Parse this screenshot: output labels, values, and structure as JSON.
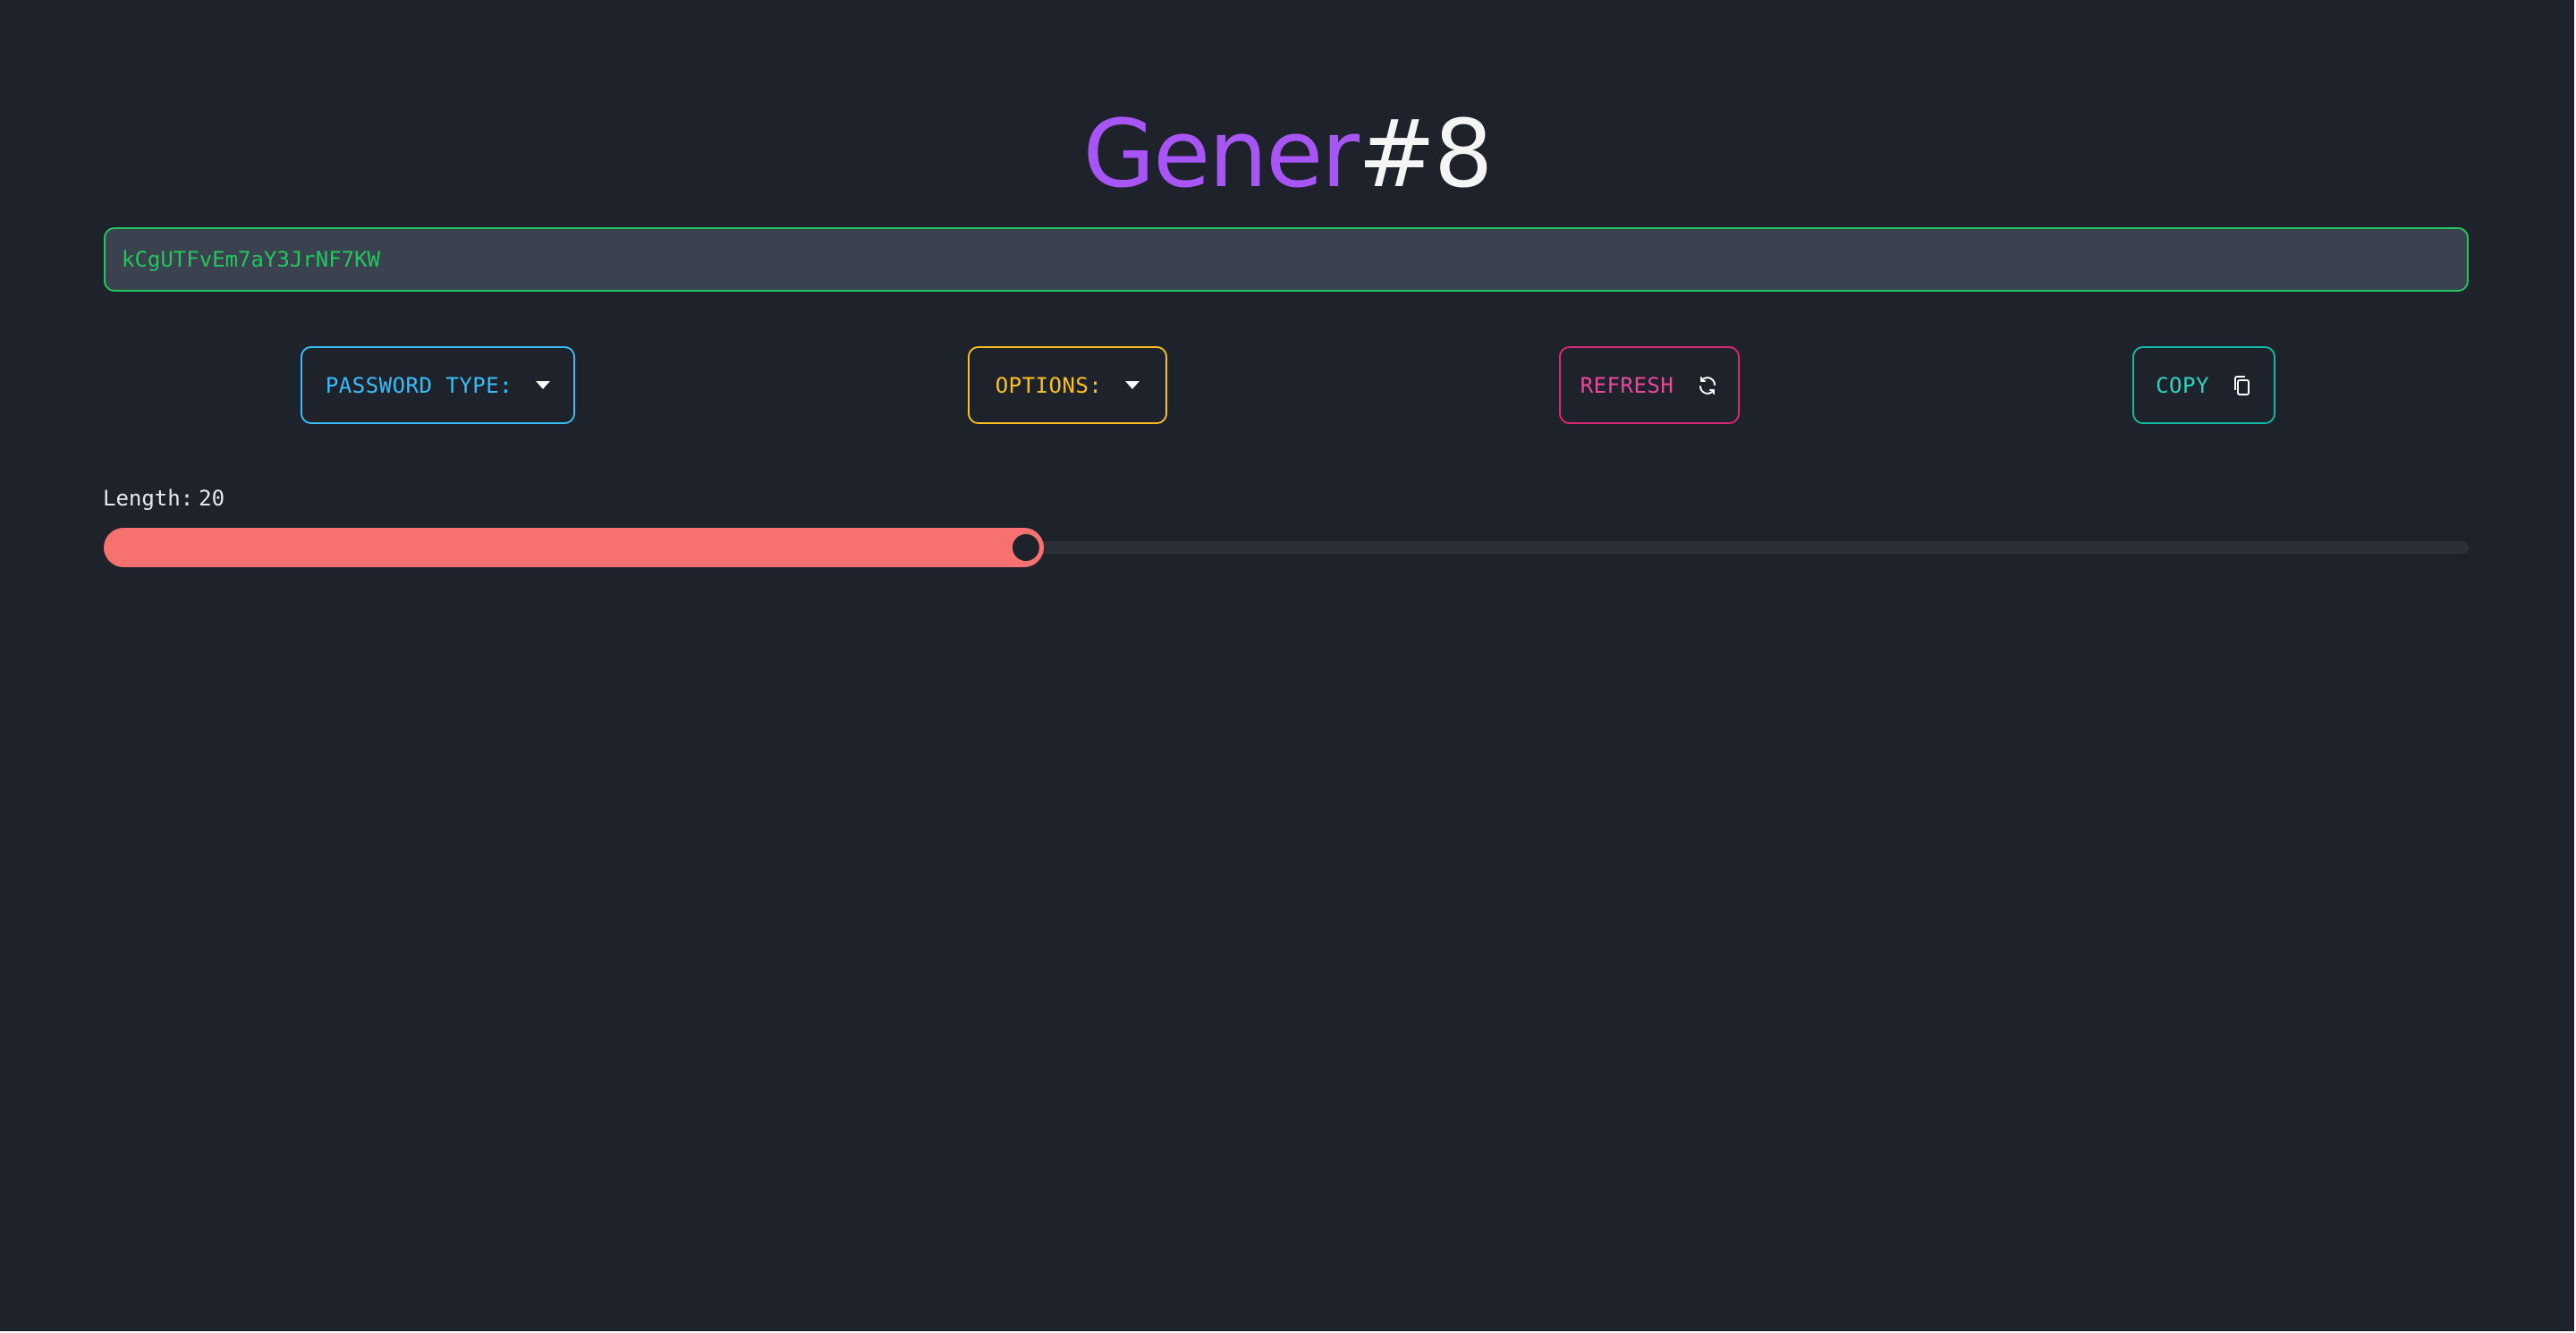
{
  "app": {
    "title_part1": "Gener",
    "title_part2": "#8"
  },
  "output": {
    "password": "kCgUTFvEm7aY3JrNF7KW"
  },
  "controls": {
    "password_type_label": "PASSWORD TYPE:",
    "options_label": "OPTIONS:",
    "refresh_label": "REFRESH",
    "copy_label": "COPY"
  },
  "length": {
    "label": "Length:",
    "value": "20",
    "fill_fraction": 0.39
  },
  "colors": {
    "title_accent": "#a855f7",
    "password_text": "#22c55e",
    "password_type": "#38bdf8",
    "options": "#fbbf24",
    "refresh": "#ec4899",
    "copy": "#2dd4bf",
    "slider": "#f87171"
  },
  "icons": {
    "dropdown": "caret-down-icon",
    "refresh": "refresh-icon",
    "copy": "copy-icon"
  }
}
